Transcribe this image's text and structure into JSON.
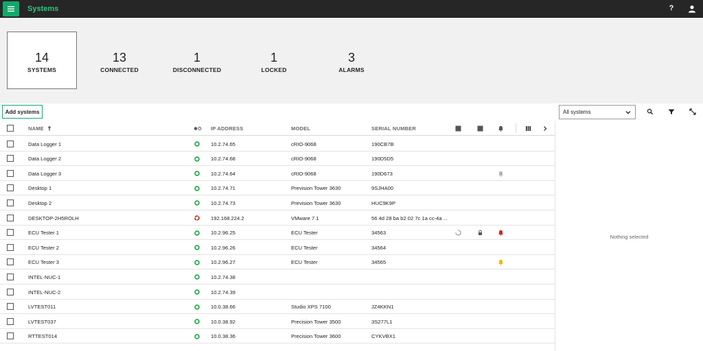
{
  "app": {
    "title": "Systems",
    "menu_icon": "hamburger-icon",
    "help_label": "?",
    "user_icon": "user-icon"
  },
  "summary": {
    "tiles": [
      {
        "count": "14",
        "label": "SYSTEMS"
      },
      {
        "count": "13",
        "label": "CONNECTED"
      },
      {
        "count": "1",
        "label": "DISCONNECTED"
      },
      {
        "count": "1",
        "label": "LOCKED"
      },
      {
        "count": "3",
        "label": "ALARMS"
      }
    ]
  },
  "toolbar": {
    "add_label": "Add systems",
    "filter_value": "All systems",
    "icons": [
      "search-icon",
      "filter-icon",
      "expand-icon"
    ]
  },
  "columns": {
    "name": "NAME",
    "status_icon": "connection-status-icon",
    "ip": "IP ADDRESS",
    "model": "MODEL",
    "serial": "SERIAL NUMBER",
    "extra_icons": [
      "stop-icon",
      "stop-icon",
      "bell-icon",
      "columns-icon",
      "chevron-right-icon"
    ]
  },
  "colors": {
    "accent": "#13a86b",
    "connected": "#1ea84a",
    "disconnected": "#c0241d",
    "alarm_red": "#d4201b",
    "alarm_yellow": "#f2b705",
    "muted": "#b5b5b5"
  },
  "rows": [
    {
      "name": "Data Logger 1",
      "status": "connected",
      "ip": "10.2.74.65",
      "model": "cRIO-9068",
      "serial": "190CB7B",
      "alarm": ""
    },
    {
      "name": "Data Logger 2",
      "status": "connected",
      "ip": "10.2.74.68",
      "model": "cRIO-9068",
      "serial": "190D5D5",
      "alarm": ""
    },
    {
      "name": "Data Logger 3",
      "status": "connected",
      "ip": "10.2.74.64",
      "model": "cRIO-9068",
      "serial": "190D673",
      "alarm": "muted"
    },
    {
      "name": "Desktop 1",
      "status": "connected",
      "ip": "10.2.74.71",
      "model": "Prevision Tower 3630",
      "serial": "9SJHA00",
      "alarm": ""
    },
    {
      "name": "Desktop 2",
      "status": "connected",
      "ip": "10.2.74.73",
      "model": "Prevision Tower 3630",
      "serial": "HUC9K9P",
      "alarm": ""
    },
    {
      "name": "DESKTOP-2H5ROLH",
      "status": "disconnected",
      "ip": "192.168.224.2",
      "model": "VMware 7.1",
      "serial": "56 4d 28 ba b2 02 7c 1a cc-4a ...",
      "alarm": ""
    },
    {
      "name": "ECU Tester 1",
      "status": "connected",
      "ip": "10.2.96.25",
      "model": "ECU Tester",
      "serial": "34563",
      "alarm": "red",
      "busy": true,
      "locked": true
    },
    {
      "name": "ECU Tester 2",
      "status": "connected",
      "ip": "10.2.96.26",
      "model": "ECU Tester",
      "serial": "34564",
      "alarm": ""
    },
    {
      "name": "ECU Tester 3",
      "status": "connected",
      "ip": "10.2.96.27",
      "model": "ECU Tester",
      "serial": "34565",
      "alarm": "yellow"
    },
    {
      "name": "INTEL-NUC-1",
      "status": "connected",
      "ip": "10.2.74.38",
      "model": "",
      "serial": "",
      "alarm": ""
    },
    {
      "name": "INTEL-NUC-2",
      "status": "connected",
      "ip": "10.2.74.39",
      "model": "",
      "serial": "",
      "alarm": ""
    },
    {
      "name": "LVTEST011",
      "status": "connected",
      "ip": "10.0.38.66",
      "model": "Studio XPS 7100",
      "serial": "JZ4KKN1",
      "alarm": ""
    },
    {
      "name": "LVTEST037",
      "status": "connected",
      "ip": "10.0.38.92",
      "model": "Precision Tower 3500",
      "serial": "3S277L1",
      "alarm": ""
    },
    {
      "name": "RTTEST014",
      "status": "connected",
      "ip": "10.0.38.36",
      "model": "Precision Tower 3600",
      "serial": "CYKVBX1",
      "alarm": ""
    }
  ],
  "detail": {
    "empty_text": "Nothing selected"
  }
}
